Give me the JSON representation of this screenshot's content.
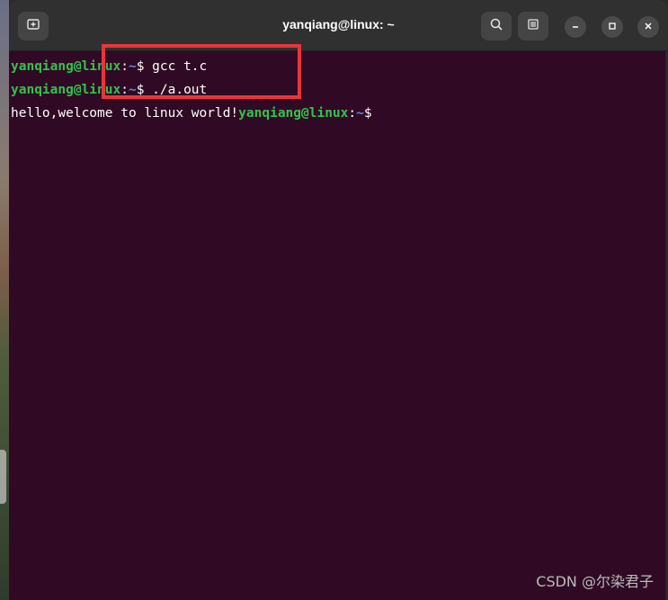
{
  "window": {
    "title": "yanqiang@linux: ~"
  },
  "icons": {
    "new_tab": "new-tab-icon",
    "search": "search-icon",
    "menu": "hamburger-menu-icon",
    "minimize": "minimize-icon",
    "maximize": "maximize-icon",
    "close": "close-icon"
  },
  "terminal": {
    "lines": [
      {
        "user": "yanqiang@linux",
        "colon": ":",
        "path": "~",
        "prompt": "$ ",
        "text": "gcc t.c"
      },
      {
        "user": "yanqiang@linux",
        "colon": ":",
        "path": "~",
        "prompt": "$ ",
        "text": "./a.out"
      },
      {
        "output": "hello,welcome to linux world!",
        "user": "yanqiang@linux",
        "colon": ":",
        "path": "~",
        "prompt": "$"
      }
    ]
  },
  "watermark": "CSDN @尔染君子",
  "colors": {
    "terminal_bg": "#300a24",
    "user": "#33c24d",
    "path": "#5f87d7",
    "highlight": "#e8353a",
    "titlebar": "#303030"
  }
}
